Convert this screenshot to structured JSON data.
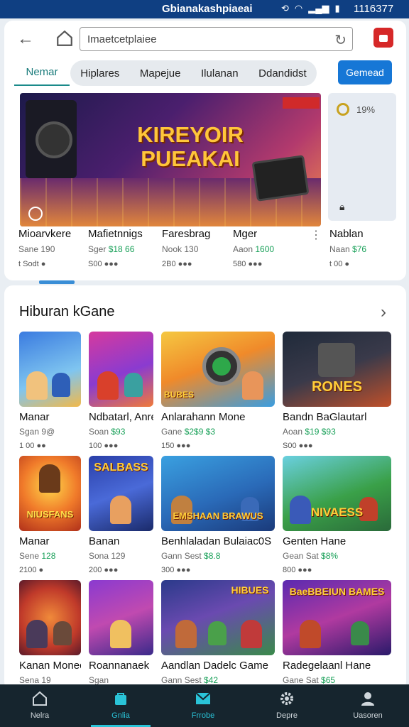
{
  "status_bar": {
    "title": "Gbianakashpiaeai",
    "time": "1116377"
  },
  "browser": {
    "search_value": "Imaetcetplaiee",
    "search_placeholder": "Imaetcetplaiee"
  },
  "tabs": {
    "active": "Nemar",
    "items": [
      "Hiplares",
      "Mapejue",
      "Ilulanan",
      "Ddandidst"
    ],
    "download_button": "Gemead"
  },
  "featured": {
    "banner_title": "KIREYOIR PUEAKAI",
    "side_card_rating": "19%",
    "items": [
      {
        "name": "Mioarvkere",
        "sub": "Sane 190",
        "price": "",
        "meta": "t Sodt ●"
      },
      {
        "name": "Mafietnnigs",
        "sub": "Sger",
        "price": "$18 66",
        "meta": "S00 ●●●"
      },
      {
        "name": "Faresbrag",
        "sub": "Nook 130",
        "price": "",
        "meta": "2B0 ●●●"
      },
      {
        "name": "Mger",
        "sub": "Aaon",
        "price": "1600",
        "meta": "580 ●●●"
      },
      {
        "name": "Nablan",
        "sub": "Naan",
        "price": "$76",
        "meta": "t 00 ●"
      }
    ]
  },
  "section": {
    "title": "Hiburan kGane",
    "games": [
      {
        "name": "Manar",
        "sub": "Sgan 9@",
        "price": "",
        "meta": "1 00 ●●"
      },
      {
        "name": "Ndbatarl, Anre",
        "sub": "Soan",
        "price": "$93",
        "meta": "100 ●●●"
      },
      {
        "name": "Anlarahann Mone",
        "sub": "Gane",
        "price": "$2$9 $3",
        "meta": "150 ●●●"
      },
      {
        "name": "Bandn BaGlautarl",
        "sub": "Aoan",
        "price": "$19 $93",
        "meta": "S00 ●●●"
      },
      {
        "name": "Manar",
        "sub": "Sene",
        "price": "128",
        "meta": "2100 ●"
      },
      {
        "name": "Banan",
        "sub": "Sona 129",
        "price": "",
        "meta": "200 ●●●"
      },
      {
        "name": "Benhlaladan Bulaiac0S",
        "sub": "Gann Sest",
        "price": "$8.8",
        "meta": "300 ●●●"
      },
      {
        "name": "Genten Hane",
        "sub": "Gean Sat",
        "price": "$8%",
        "meta": "800 ●●●"
      },
      {
        "name": "Kanan Monecbody",
        "sub": "Sena 19",
        "price": "",
        "meta": ""
      },
      {
        "name": "Roannanaek",
        "sub": "Sgan",
        "price": "",
        "meta": ""
      },
      {
        "name": "Aandlan Dadelc Game",
        "sub": "Gann Sest",
        "price": "$42",
        "meta": ""
      },
      {
        "name": "Radegelaanl Hane",
        "sub": "Gane Sat",
        "price": "$65",
        "meta": ""
      }
    ],
    "thumb_captions": [
      "",
      "",
      "BUBES",
      "RONES",
      "NIUSFANS",
      "SALBASS",
      "EMSHAAN BRAWUS",
      "NIVAESS",
      "",
      "",
      "HIBUES",
      "BaeBBEIUN BAMES"
    ]
  },
  "bottom_nav": {
    "items": [
      "Nelra",
      "Gnlia",
      "Frrobe",
      "Depre",
      "Uasoren"
    ],
    "active_index": 1
  },
  "colors": {
    "accent": "#1677d6",
    "status_bar": "#0f3f82",
    "nav_bg": "#16252e",
    "price": "#18a058"
  }
}
